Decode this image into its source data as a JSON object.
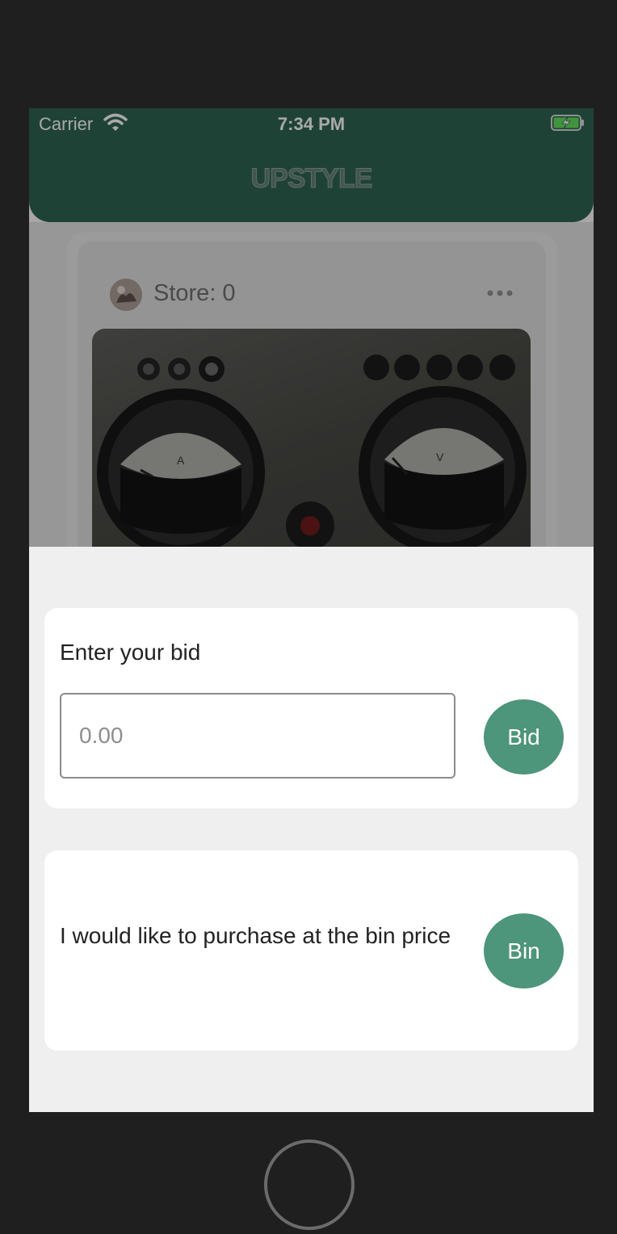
{
  "status_bar": {
    "carrier": "Carrier",
    "time": "7:34 PM",
    "wifi_icon": "wifi-icon",
    "battery_icon": "battery-charging-icon"
  },
  "header": {
    "title": "UPSTYLE",
    "color": "#2d5f4f"
  },
  "post": {
    "store_label": "Store: 0",
    "more_icon": "more-horizontal-icon",
    "image_icon": "product-photo-voltmeter-ammeter"
  },
  "bid_panel": {
    "label": "Enter your bid",
    "input_placeholder": "0.00",
    "button_label": "Bid"
  },
  "bin_panel": {
    "text": "I would like to purchase at the bin price",
    "button_label": "Bin"
  },
  "colors": {
    "accent": "#4d957b",
    "sheet_bg": "#f0eff0"
  }
}
